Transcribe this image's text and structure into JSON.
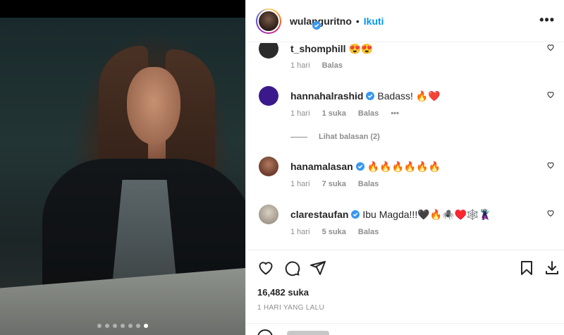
{
  "post": {
    "author": "wulanguritno",
    "follow_label": "Ikuti",
    "separator": "•",
    "more_label": "•••",
    "carousel_dots": 7,
    "carousel_active_index": 6
  },
  "comments": [
    {
      "user": "t_shomphill",
      "text": "😍😍",
      "verified": false,
      "time": "1 hari",
      "likes": "",
      "reply_label": "Balas",
      "avatar_color": "#2b2b2b"
    },
    {
      "user": "hannahalrashid",
      "text": "Badass! 🔥❤️",
      "verified": true,
      "time": "1 hari",
      "likes": "1 suka",
      "reply_label": "Balas",
      "more": "•••",
      "avatar_color": "#3a1a8a"
    },
    {
      "user": "hanamalasan",
      "text": "🔥🔥🔥🔥🔥🔥",
      "verified": true,
      "time": "1 hari",
      "likes": "7 suka",
      "reply_label": "Balas",
      "avatar_color": "#6b3a2c"
    },
    {
      "user": "clarestaufan",
      "text": "Ibu Magda!!!🖤🔥🕷️♥️🕸️🦹",
      "verified": true,
      "time": "1 hari",
      "likes": "5 suka",
      "reply_label": "Balas",
      "avatar_color": "#c8c0b0"
    }
  ],
  "view_replies": "Lihat balasan (2)",
  "likes_count": "16,482 suka",
  "posted_ago": "1 HARI YANG LALU",
  "colors": {
    "link_blue": "#0095f6",
    "verified_blue": "#3897f0",
    "text": "#262626",
    "muted": "#8e8e8e"
  }
}
